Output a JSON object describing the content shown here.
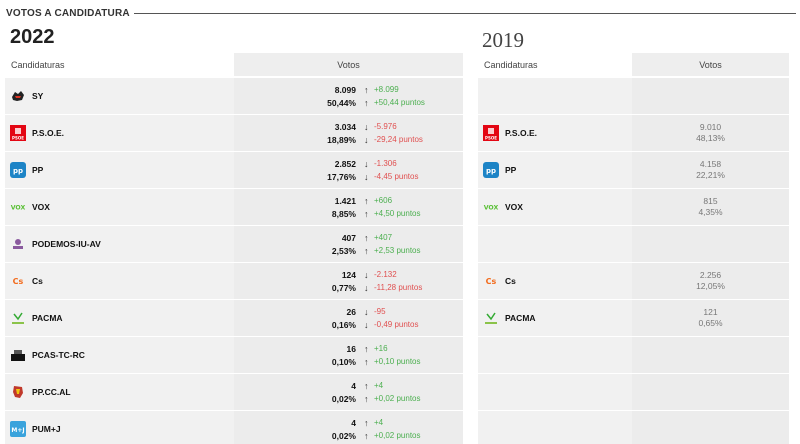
{
  "section_title": "VOTOS A CANDIDATURA",
  "year_current": "2022",
  "year_previous": "2019",
  "columns": {
    "party": "Candidaturas",
    "votes": "Votos"
  },
  "colors": {
    "up": "#4caf50",
    "down": "#e05050"
  },
  "rows_2022": [
    {
      "name": "SY",
      "logo": "sy-logo-icon",
      "votes": "8.099",
      "votes_delta": "+8.099",
      "votes_dir": "up",
      "pct": "50,44%",
      "pct_delta": "+50,44 puntos",
      "pct_dir": "up"
    },
    {
      "name": "P.S.O.E.",
      "logo": "psoe-logo-icon",
      "votes": "3.034",
      "votes_delta": "-5.976",
      "votes_dir": "down",
      "pct": "18,89%",
      "pct_delta": "-29,24 puntos",
      "pct_dir": "down"
    },
    {
      "name": "PP",
      "logo": "pp-logo-icon",
      "votes": "2.852",
      "votes_delta": "-1.306",
      "votes_dir": "down",
      "pct": "17,76%",
      "pct_delta": "-4,45 puntos",
      "pct_dir": "down"
    },
    {
      "name": "VOX",
      "logo": "vox-logo-icon",
      "votes": "1.421",
      "votes_delta": "+606",
      "votes_dir": "up",
      "pct": "8,85%",
      "pct_delta": "+4,50 puntos",
      "pct_dir": "up"
    },
    {
      "name": "PODEMOS-IU-AV",
      "logo": "podemos-logo-icon",
      "votes": "407",
      "votes_delta": "+407",
      "votes_dir": "up",
      "pct": "2,53%",
      "pct_delta": "+2,53 puntos",
      "pct_dir": "up"
    },
    {
      "name": "Cs",
      "logo": "cs-logo-icon",
      "votes": "124",
      "votes_delta": "-2.132",
      "votes_dir": "down",
      "pct": "0,77%",
      "pct_delta": "-11,28 puntos",
      "pct_dir": "down"
    },
    {
      "name": "PACMA",
      "logo": "pacma-logo-icon",
      "votes": "26",
      "votes_delta": "-95",
      "votes_dir": "down",
      "pct": "0,16%",
      "pct_delta": "-0,49 puntos",
      "pct_dir": "down"
    },
    {
      "name": "PCAS-TC-RC",
      "logo": "pcas-logo-icon",
      "votes": "16",
      "votes_delta": "+16",
      "votes_dir": "up",
      "pct": "0,10%",
      "pct_delta": "+0,10 puntos",
      "pct_dir": "up"
    },
    {
      "name": "PP.CC.AL",
      "logo": "ppccal-logo-icon",
      "votes": "4",
      "votes_delta": "+4",
      "votes_dir": "up",
      "pct": "0,02%",
      "pct_delta": "+0,02 puntos",
      "pct_dir": "up"
    },
    {
      "name": "PUM+J",
      "logo": "pumj-logo-icon",
      "votes": "4",
      "votes_delta": "+4",
      "votes_dir": "up",
      "pct": "0,02%",
      "pct_delta": "+0,02 puntos",
      "pct_dir": "up"
    }
  ],
  "rows_2019": [
    {
      "name": "",
      "votes": "",
      "pct": ""
    },
    {
      "name": "P.S.O.E.",
      "logo": "psoe-logo-icon",
      "votes": "9.010",
      "pct": "48,13%"
    },
    {
      "name": "PP",
      "logo": "pp-logo-icon",
      "votes": "4.158",
      "pct": "22,21%"
    },
    {
      "name": "VOX",
      "logo": "vox-logo-icon",
      "votes": "815",
      "pct": "4,35%"
    },
    {
      "name": "",
      "votes": "",
      "pct": ""
    },
    {
      "name": "Cs",
      "logo": "cs-logo-icon",
      "votes": "2.256",
      "pct": "12,05%"
    },
    {
      "name": "PACMA",
      "logo": "pacma-logo-icon",
      "votes": "121",
      "pct": "0,65%"
    },
    {
      "name": "",
      "votes": "",
      "pct": ""
    },
    {
      "name": "",
      "votes": "",
      "pct": ""
    },
    {
      "name": "",
      "votes": "",
      "pct": ""
    }
  ]
}
